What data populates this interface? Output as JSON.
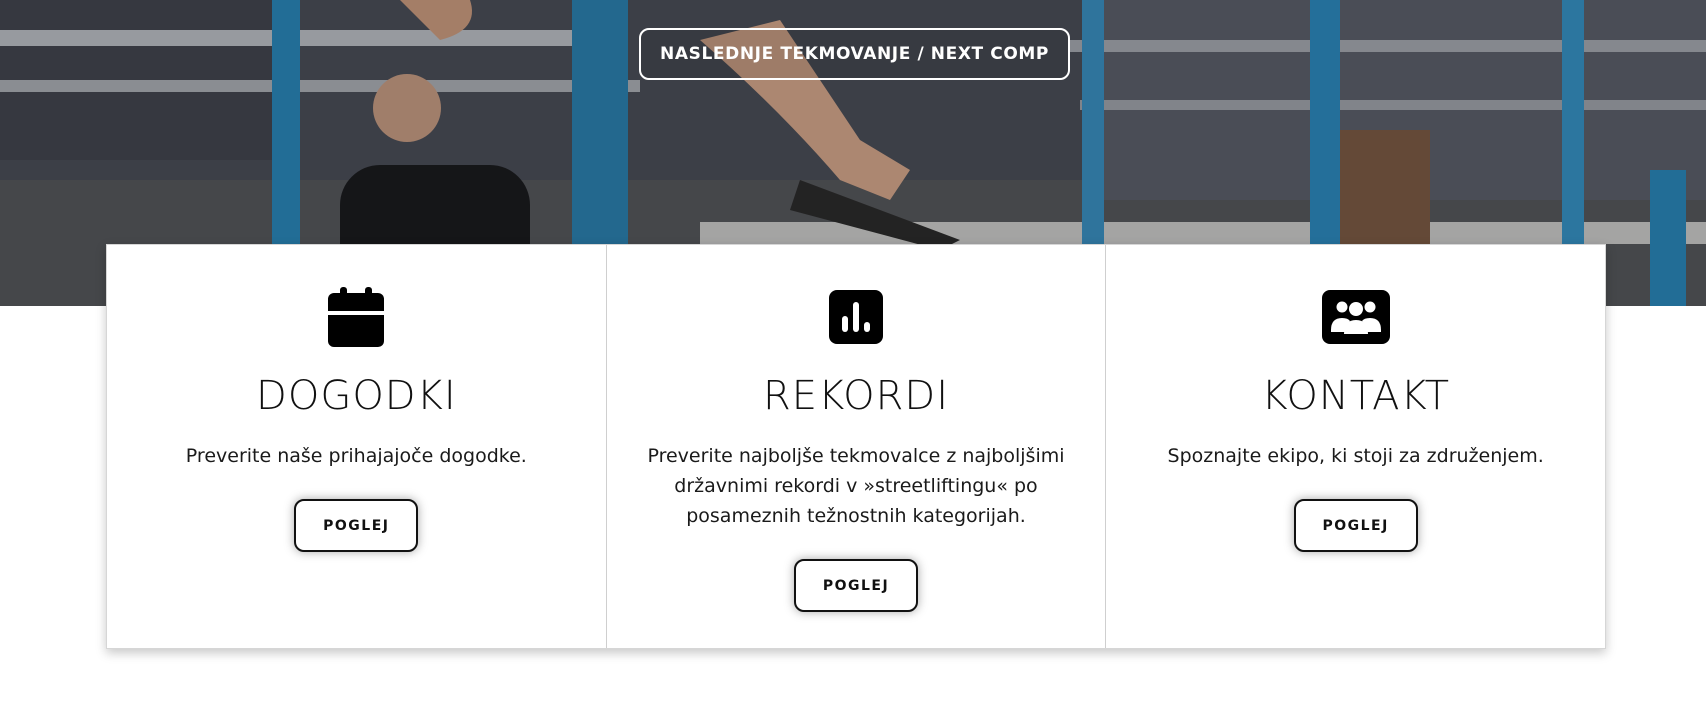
{
  "hero": {
    "cta_label": "NASLEDNJE TEKMOVANJE / NEXT COMP"
  },
  "cards": [
    {
      "icon": "calendar-icon",
      "title": "DOGODKI",
      "text": "Preverite naše prihajajoče dogodke.",
      "button_label": "POGLEJ"
    },
    {
      "icon": "bar-chart-icon",
      "title": "REKORDI",
      "text": "Preverite najboljše tekmovalce z najboljšimi državnimi rekordi v »streetliftingu« po posameznih težnostnih kategorijah.",
      "button_label": "POGLEJ"
    },
    {
      "icon": "people-group-icon",
      "title": "KONTAKT",
      "text": "Spoznajte ekipo, ki stoji za združenjem.",
      "button_label": "POGLEJ"
    }
  ],
  "colors": {
    "text": "#111111",
    "bar_blue": "#2a86b8",
    "card_border": "#cfcfcf"
  }
}
